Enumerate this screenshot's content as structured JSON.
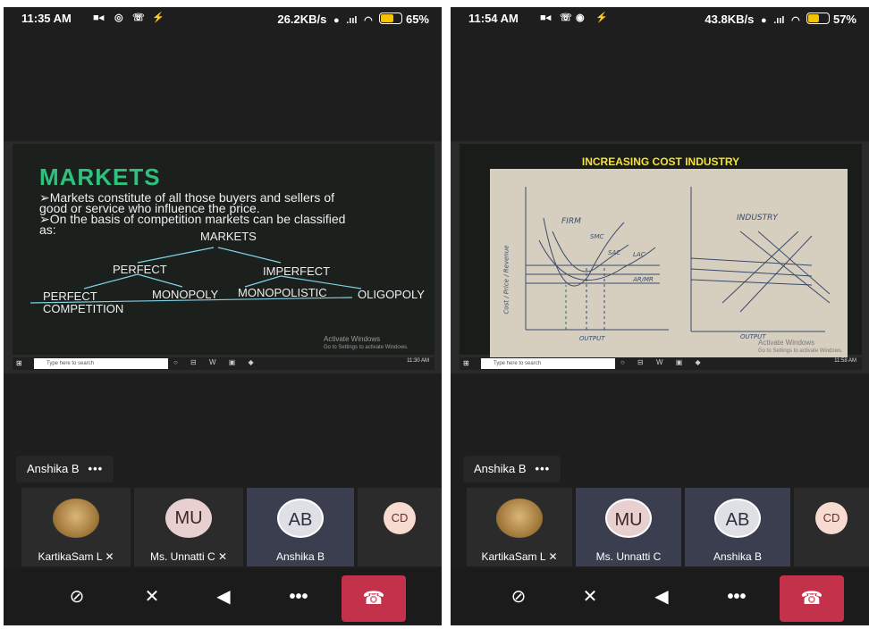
{
  "left": {
    "status": {
      "time": "11:35 AM",
      "speed": "26.2KB/s",
      "signal": ".ııl",
      "battery": "65%"
    },
    "slide": {
      "title": "MARKETS",
      "bullet1_line1": "➢Markets constitute of  all those buyers and sellers of",
      "bullet1_line2": "good or service who influence the price.",
      "bullet2_line1": "➢On the basis of competition markets can be classified",
      "bullet2_line2": "as:",
      "tree": {
        "root": "MARKETS",
        "perfect": "PERFECT",
        "imperfect": "IMPERFECT",
        "perfect_competition_1": "PERFECT",
        "perfect_competition_2": "COMPETITION",
        "monopoly": "MONOPOLY",
        "monopolistic": "MONOPOLISTIC",
        "oligopoly": "OLIGOPOLY"
      },
      "watermark_1": "Activate Windows",
      "watermark_2": "Go to Settings to activate Windows."
    },
    "taskbar": {
      "search": "Type here to search",
      "tray": "11:30 AM"
    },
    "presenter": "Anshika B",
    "participants": [
      {
        "initials": "",
        "name": "KartikaSam L"
      },
      {
        "initials": "MU",
        "name": "Ms. Unnatti C"
      },
      {
        "initials": "AB",
        "name": "Anshika B"
      },
      {
        "initials": "CD",
        "name": ""
      }
    ]
  },
  "right": {
    "status": {
      "time": "11:54 AM",
      "speed": "43.8KB/s",
      "signal": ".ııl",
      "battery": "57%"
    },
    "slide": {
      "title": "INCREASING COST INDUSTRY",
      "firm": "FIRM",
      "industry": "INDUSTRY",
      "y_axis": "Cost / Price / Revenue",
      "output_1": "OUTPUT",
      "output_2": "OUTPUT",
      "lac": "LAC",
      "smc": "SMC",
      "sac": "SAC",
      "ar_mr": "AR/MR",
      "watermark_1": "Activate Windows",
      "watermark_2": "Go to Settings to activate Windows."
    },
    "taskbar": {
      "search": "Type here to search",
      "tray": "11:58 AM"
    },
    "presenter": "Anshika B",
    "participants": [
      {
        "initials": "",
        "name": "KartikaSam L"
      },
      {
        "initials": "MU",
        "name": "Ms. Unnatti C"
      },
      {
        "initials": "AB",
        "name": "Anshika B"
      },
      {
        "initials": "CD",
        "name": ""
      }
    ]
  }
}
